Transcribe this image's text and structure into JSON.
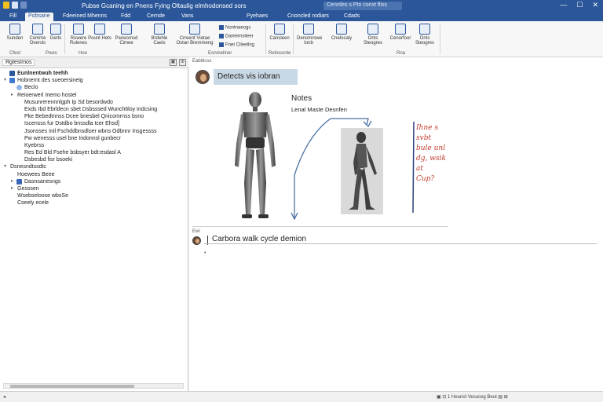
{
  "app": {
    "window_title": "Pubse Gcaning en Pnens Fying Oltaulig elmhodonsed sors",
    "search_placeholder": "Cenrdes s Ptn conxt fliss",
    "window_controls": [
      "—",
      "☐",
      "✕"
    ]
  },
  "tabs": [
    "Fill",
    "Pobsane",
    "Fdeeined Mhenns",
    "Fdd",
    "Cernde",
    "Vans",
    "Pyehaes",
    "Cnoncled rodiars",
    "Cdads"
  ],
  "active_tab": "Pobsane",
  "ribbon": {
    "buttons": [
      "Sunden",
      "Comme Oversls",
      "Gerts",
      "Ruwere Rulenes",
      "Pount Hets",
      "Paneornsd Cimee",
      "Brdehle Caels",
      "Crreent Vietae Ostan Bremmeng",
      "Cansleen",
      "Denomrowe Ionb",
      "Cnelocaly",
      "Onts Steogres",
      "Cenorfoor"
    ],
    "small_items": [
      "Nontnaeogs",
      "Damernslieer",
      "Fnet Clleetlng"
    ],
    "groups": [
      "Cfest",
      "Pwes",
      "Hoo",
      "Eonmeliner",
      "Retiosonle",
      "Rna"
    ]
  },
  "left_pane": {
    "tab_label": "Rgtestmos",
    "tree": [
      {
        "indent": 0,
        "twisty": "",
        "icon": "page",
        "text": "Eunlnentwuh teehh",
        "bold": true
      },
      {
        "indent": 0,
        "twisty": "▾",
        "icon": "section",
        "text": "Hobnernt des sueoersineig"
      },
      {
        "indent": 1,
        "twisty": "",
        "icon": "cloud",
        "text": "Beclo"
      },
      {
        "indent": 1,
        "twisty": "▸",
        "icon": "",
        "text": "Reioerwerl Inemo hostel"
      },
      {
        "indent": 2,
        "twisty": "",
        "icon": "",
        "text": "Musunrerennnlgph Ip Sd besordwdo"
      },
      {
        "indent": 2,
        "twisty": "",
        "icon": "",
        "text": "Exds Ibd Ebrldecn sbet Dsbsssed Wunch6loy Indcsing"
      },
      {
        "indent": 2,
        "twisty": "",
        "icon": "",
        "text": "Pke Bebedtnnss Dcee bnesbel Qnicomrnss bsno"
      },
      {
        "indent": 2,
        "twisty": "",
        "icon": "",
        "text": "Iscensss fur Dstdbo bnssdla tcer Ehsd]"
      },
      {
        "indent": 2,
        "twisty": "",
        "icon": "",
        "text": "Jsonsses Inil Fschddbnsdloer wbns Odbnnr Insgessss"
      },
      {
        "indent": 2,
        "twisty": "",
        "icon": "",
        "text": "Pw wenesss usel bne Indonnsl gunbecr"
      },
      {
        "indent": 2,
        "twisty": "",
        "icon": "",
        "text": "Kyebrss"
      },
      {
        "indent": 2,
        "twisty": "",
        "icon": "",
        "text": "Res Ed Bld Fsehe bsbsyer bdt:esdasl A"
      },
      {
        "indent": 2,
        "twisty": "",
        "icon": "",
        "text": "Dsbesbd fisr bsoeki"
      },
      {
        "indent": 0,
        "twisty": "▾",
        "icon": "",
        "text": "Dsnesndtssdtc"
      },
      {
        "indent": 1,
        "twisty": "",
        "icon": "",
        "text": "Hoewees Beee"
      },
      {
        "indent": 1,
        "twisty": "▸",
        "icon": "doc",
        "text": "Dasnsanesngs"
      },
      {
        "indent": 1,
        "twisty": "▸",
        "icon": "",
        "text": "Gesssen"
      },
      {
        "indent": 1,
        "twisty": "",
        "icon": "",
        "text": "Wsebseloose wbsSe"
      },
      {
        "indent": 1,
        "twisty": "",
        "icon": "",
        "text": "Cseely ecele"
      }
    ]
  },
  "main": {
    "header_label": "Eabldcss",
    "title_box": "Detects vis iobran",
    "notes_heading": "Notes",
    "notes_subheading": "Lenal Maste Desnfen",
    "red_annotation": [
      "Ihne s",
      "svbt",
      "bule unl",
      "dg, wsik",
      "at",
      "Cup?"
    ],
    "caption_label": "Ewi",
    "caption": "Carbora walk cycle demion"
  },
  "statusbar": {
    "left": "◂",
    "right": "▣   ⊡  1 Heunol Vesuceg Beut  ▤   ⊞"
  }
}
